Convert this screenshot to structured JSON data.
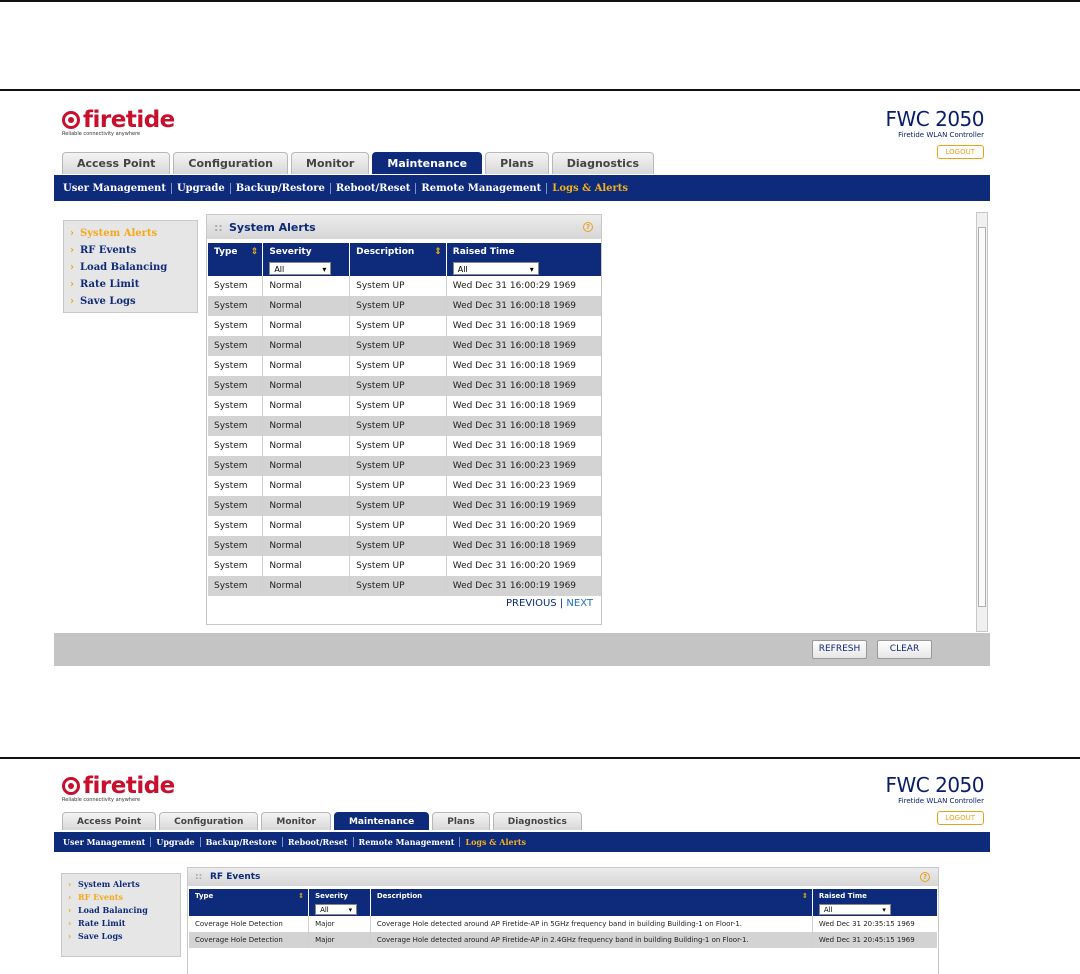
{
  "screen1": {
    "brand": "firetide",
    "tagline": "Reliable connectivity anywhere",
    "product_name": "FWC 2050",
    "product_sub": "Firetide WLAN Controller",
    "logout": "LOGOUT",
    "tabs": [
      "Access Point",
      "Configuration",
      "Monitor",
      "Maintenance",
      "Plans",
      "Diagnostics"
    ],
    "active_tab": "Maintenance",
    "subnav": [
      "User Management",
      "Upgrade",
      "Backup/Restore",
      "Reboot/Reset",
      "Remote Management",
      "Logs & Alerts"
    ],
    "active_subnav": "Logs & Alerts",
    "left_nav": [
      "System Alerts",
      "RF Events",
      "Load Balancing",
      "Rate Limit",
      "Save Logs"
    ],
    "active_left": "System Alerts",
    "panel_title": "System Alerts",
    "columns": [
      "Type",
      "Severity",
      "Description",
      "Raised Time"
    ],
    "filters": {
      "severity": "All",
      "raised_time": "All"
    },
    "rows": [
      [
        "System",
        "Normal",
        "System UP",
        "Wed Dec 31 16:00:29 1969"
      ],
      [
        "System",
        "Normal",
        "System UP",
        "Wed Dec 31 16:00:18 1969"
      ],
      [
        "System",
        "Normal",
        "System UP",
        "Wed Dec 31 16:00:18 1969"
      ],
      [
        "System",
        "Normal",
        "System UP",
        "Wed Dec 31 16:00:18 1969"
      ],
      [
        "System",
        "Normal",
        "System UP",
        "Wed Dec 31 16:00:18 1969"
      ],
      [
        "System",
        "Normal",
        "System UP",
        "Wed Dec 31 16:00:18 1969"
      ],
      [
        "System",
        "Normal",
        "System UP",
        "Wed Dec 31 16:00:18 1969"
      ],
      [
        "System",
        "Normal",
        "System UP",
        "Wed Dec 31 16:00:18 1969"
      ],
      [
        "System",
        "Normal",
        "System UP",
        "Wed Dec 31 16:00:18 1969"
      ],
      [
        "System",
        "Normal",
        "System UP",
        "Wed Dec 31 16:00:23 1969"
      ],
      [
        "System",
        "Normal",
        "System UP",
        "Wed Dec 31 16:00:23 1969"
      ],
      [
        "System",
        "Normal",
        "System UP",
        "Wed Dec 31 16:00:19 1969"
      ],
      [
        "System",
        "Normal",
        "System UP",
        "Wed Dec 31 16:00:20 1969"
      ],
      [
        "System",
        "Normal",
        "System UP",
        "Wed Dec 31 16:00:18 1969"
      ],
      [
        "System",
        "Normal",
        "System UP",
        "Wed Dec 31 16:00:20 1969"
      ],
      [
        "System",
        "Normal",
        "System UP",
        "Wed Dec 31 16:00:19 1969"
      ]
    ],
    "pager_prev": "PREVIOUS",
    "pager_sep": "|",
    "pager_next": "NEXT",
    "refresh": "REFRESH",
    "clear": "CLEAR"
  },
  "screen2": {
    "brand": "firetide",
    "tagline": "Reliable connectivity anywhere",
    "product_name": "FWC 2050",
    "product_sub": "Firetide WLAN Controller",
    "logout": "LOGOUT",
    "tabs": [
      "Access Point",
      "Configuration",
      "Monitor",
      "Maintenance",
      "Plans",
      "Diagnostics"
    ],
    "active_tab": "Maintenance",
    "subnav": [
      "User Management",
      "Upgrade",
      "Backup/Restore",
      "Reboot/Reset",
      "Remote Management",
      "Logs & Alerts"
    ],
    "active_subnav": "Logs & Alerts",
    "left_nav": [
      "System Alerts",
      "RF Events",
      "Load Balancing",
      "Rate Limit",
      "Save Logs"
    ],
    "active_left": "RF Events",
    "panel_title": "RF Events",
    "columns": [
      "Type",
      "Severity",
      "Description",
      "Raised Time"
    ],
    "filters": {
      "severity": "All",
      "raised_time": "All"
    },
    "rows": [
      [
        "Coverage Hole Detection",
        "Major",
        "Coverage Hole detected around AP Firetide-AP in 5GHz frequency band in building Building-1 on Floor-1.",
        "Wed Dec 31 20:35:15 1969"
      ],
      [
        "Coverage Hole Detection",
        "Major",
        "Coverage Hole detected around AP Firetide-AP in 2.4GHz frequency band in building Building-1 on Floor-1.",
        "Wed Dec 31 20:45:15 1969"
      ]
    ]
  },
  "colors": {
    "navy": "#0e2a7a",
    "accent": "#f5b01c",
    "brand_red": "#c8102e"
  }
}
